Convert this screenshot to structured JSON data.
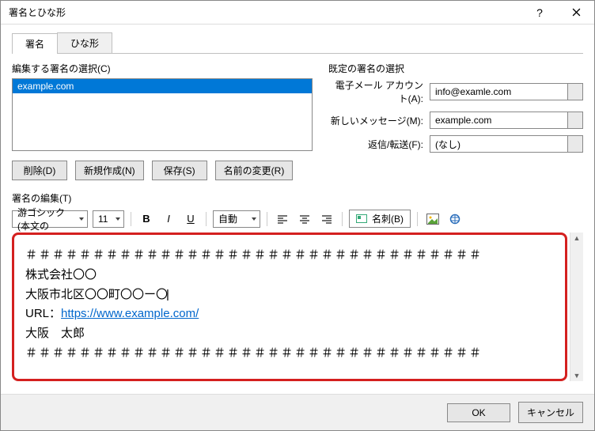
{
  "window": {
    "title": "署名とひな形"
  },
  "tabs": {
    "signature": "署名",
    "template": "ひな形"
  },
  "left": {
    "select_label": "編集する署名の選択(C)",
    "list_item": "example.com",
    "btn_delete": "削除(D)",
    "btn_new": "新規作成(N)",
    "btn_save": "保存(S)",
    "btn_rename": "名前の変更(R)"
  },
  "right": {
    "default_label": "既定の署名の選択",
    "account_label": "電子メール アカウント(A):",
    "account_value": "info@examle.com",
    "newmsg_label": "新しいメッセージ(M):",
    "newmsg_value": "example.com",
    "reply_label": "返信/転送(F):",
    "reply_value": "(なし)"
  },
  "edit": {
    "label": "署名の編集(T)",
    "font": "游ゴシック (本文の",
    "size": "11",
    "auto": "自動",
    "card_label": "名刺(B)"
  },
  "content": {
    "hash": "＃＃＃＃＃＃＃＃＃＃＃＃＃＃＃＃＃＃＃＃＃＃＃＃＃＃＃＃＃＃＃＃＃＃",
    "line1": "株式会社〇〇",
    "line2": "大阪市北区〇〇町〇〇ー〇",
    "url_label": "URL：",
    "url": "https://www.example.com/",
    "line4": "大阪　太郎"
  },
  "footer": {
    "ok": "OK",
    "cancel": "キャンセル"
  }
}
